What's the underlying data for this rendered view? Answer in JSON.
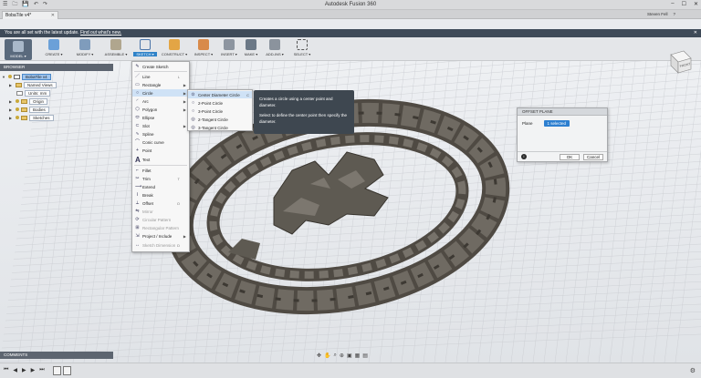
{
  "titlebar": {
    "title": "Autodesk Fusion 360",
    "quick_access": [
      "☰",
      "🗀",
      "💾",
      "↶",
      "↷"
    ],
    "window_controls": [
      "–",
      "☐",
      "✕"
    ]
  },
  "tabbar": {
    "tab_label": "BobaTile v4*",
    "tab_close": "✕",
    "user_name": "Steven Fell",
    "help": "?"
  },
  "notification": {
    "text": "You are all set with the latest update.",
    "link": "Find out what's new.",
    "close": "✕"
  },
  "toolbar": {
    "model": "MODEL ▾",
    "create": "CREATE ▾",
    "modify": "MODIFY ▾",
    "assemble": "ASSEMBLE ▾",
    "sketch": "SKETCH ▾",
    "construct": "CONSTRUCT ▾",
    "inspect": "INSPECT ▾",
    "insert": "INSERT ▾",
    "make": "MAKE ▾",
    "addins": "ADD-INS ▾",
    "select": "SELECT ▾"
  },
  "browser": {
    "header": "BROWSER",
    "items": [
      {
        "label": "BobaTile v4"
      },
      {
        "label": "Named Views"
      },
      {
        "label": "Units: mm"
      },
      {
        "label": "Origin"
      },
      {
        "label": "Bodies"
      },
      {
        "label": "Sketches"
      }
    ]
  },
  "create_menu": {
    "items": [
      {
        "label": "Create Sketch",
        "icon": "✎"
      },
      {
        "label": "Line",
        "icon": "／",
        "shortcut": "L"
      },
      {
        "label": "Rectangle",
        "icon": "▭"
      },
      {
        "label": "Circle",
        "icon": "○"
      },
      {
        "label": "Arc",
        "icon": "◜"
      },
      {
        "label": "Polygon",
        "icon": "⬡"
      },
      {
        "label": "Ellipse",
        "icon": "⬭"
      },
      {
        "label": "Slot",
        "icon": "⊂"
      },
      {
        "label": "Spline",
        "icon": "∿"
      },
      {
        "label": "Conic curve",
        "icon": "⌒"
      },
      {
        "label": "Point",
        "icon": "+"
      },
      {
        "label": "Text",
        "icon": "A"
      },
      {
        "label": "Fillet",
        "icon": "⌐"
      },
      {
        "label": "Trim",
        "icon": "✂",
        "shortcut": "T"
      },
      {
        "label": "Extend",
        "icon": "⟶"
      },
      {
        "label": "Break",
        "icon": "⌇"
      },
      {
        "label": "Offset",
        "icon": "⟂",
        "shortcut": "O"
      },
      {
        "label": "Mirror",
        "icon": "⇋"
      },
      {
        "label": "Circular Pattern",
        "icon": "⟳"
      },
      {
        "label": "Rectangular Pattern",
        "icon": "⊞"
      },
      {
        "label": "Project / Include",
        "icon": "⇲"
      },
      {
        "label": "Sketch Dimension",
        "icon": "↔",
        "shortcut": "D"
      }
    ]
  },
  "circle_submenu": {
    "items": [
      {
        "label": "Center Diameter Circle",
        "shortcut": "C"
      },
      {
        "label": "2-Point Circle"
      },
      {
        "label": "3-Point Circle"
      },
      {
        "label": "2-Tangent Circle"
      },
      {
        "label": "3-Tangent Circle"
      }
    ]
  },
  "tooltip": {
    "line1": "Creates a circle using a center point and diameter.",
    "line2": "Select to define the center point then specify the diameter."
  },
  "offset_dialog": {
    "title": "OFFSET PLANE",
    "plane_label": "Plane",
    "plane_value": "1 selected",
    "ok": "OK",
    "cancel": "Cancel",
    "info": "i"
  },
  "viewcube": {
    "face": "FRONT"
  },
  "comments": {
    "header": "COMMENTS"
  },
  "navbar": {
    "icons": [
      "✥",
      "✋",
      "⌕",
      "⊕",
      "▣",
      "▦",
      "▤"
    ]
  },
  "timeline": {
    "controls": [
      "⏮",
      "◀",
      "▶",
      "▶",
      "⏭"
    ],
    "settings": "⚙"
  },
  "colors": {
    "accent": "#2e82c8",
    "notify_bg": "#3e4a58",
    "model_fill": "#5d5850",
    "grid": "#c9ccd1"
  }
}
